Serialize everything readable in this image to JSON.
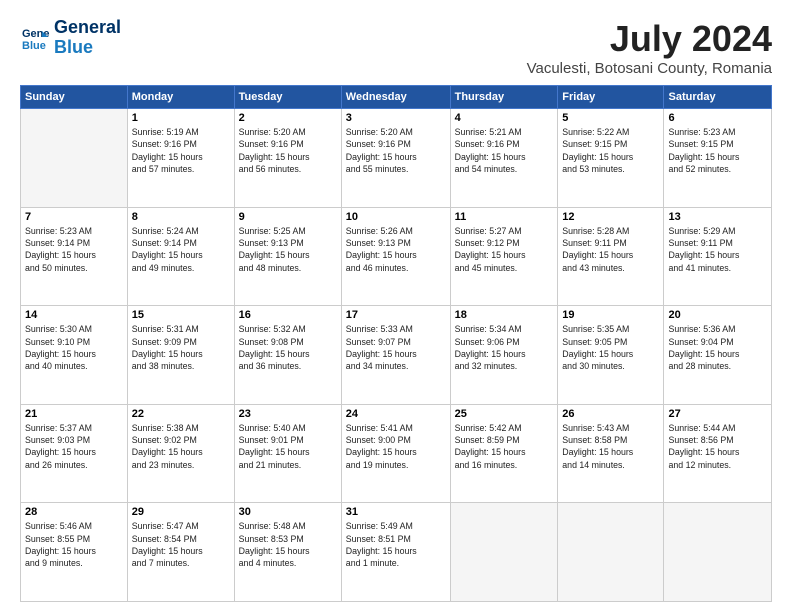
{
  "header": {
    "logo_line1": "General",
    "logo_line2": "Blue",
    "title": "July 2024",
    "subtitle": "Vaculesti, Botosani County, Romania"
  },
  "weekdays": [
    "Sunday",
    "Monday",
    "Tuesday",
    "Wednesday",
    "Thursday",
    "Friday",
    "Saturday"
  ],
  "weeks": [
    [
      {
        "day": "",
        "info": ""
      },
      {
        "day": "1",
        "info": "Sunrise: 5:19 AM\nSunset: 9:16 PM\nDaylight: 15 hours\nand 57 minutes."
      },
      {
        "day": "2",
        "info": "Sunrise: 5:20 AM\nSunset: 9:16 PM\nDaylight: 15 hours\nand 56 minutes."
      },
      {
        "day": "3",
        "info": "Sunrise: 5:20 AM\nSunset: 9:16 PM\nDaylight: 15 hours\nand 55 minutes."
      },
      {
        "day": "4",
        "info": "Sunrise: 5:21 AM\nSunset: 9:16 PM\nDaylight: 15 hours\nand 54 minutes."
      },
      {
        "day": "5",
        "info": "Sunrise: 5:22 AM\nSunset: 9:15 PM\nDaylight: 15 hours\nand 53 minutes."
      },
      {
        "day": "6",
        "info": "Sunrise: 5:23 AM\nSunset: 9:15 PM\nDaylight: 15 hours\nand 52 minutes."
      }
    ],
    [
      {
        "day": "7",
        "info": "Sunrise: 5:23 AM\nSunset: 9:14 PM\nDaylight: 15 hours\nand 50 minutes."
      },
      {
        "day": "8",
        "info": "Sunrise: 5:24 AM\nSunset: 9:14 PM\nDaylight: 15 hours\nand 49 minutes."
      },
      {
        "day": "9",
        "info": "Sunrise: 5:25 AM\nSunset: 9:13 PM\nDaylight: 15 hours\nand 48 minutes."
      },
      {
        "day": "10",
        "info": "Sunrise: 5:26 AM\nSunset: 9:13 PM\nDaylight: 15 hours\nand 46 minutes."
      },
      {
        "day": "11",
        "info": "Sunrise: 5:27 AM\nSunset: 9:12 PM\nDaylight: 15 hours\nand 45 minutes."
      },
      {
        "day": "12",
        "info": "Sunrise: 5:28 AM\nSunset: 9:11 PM\nDaylight: 15 hours\nand 43 minutes."
      },
      {
        "day": "13",
        "info": "Sunrise: 5:29 AM\nSunset: 9:11 PM\nDaylight: 15 hours\nand 41 minutes."
      }
    ],
    [
      {
        "day": "14",
        "info": "Sunrise: 5:30 AM\nSunset: 9:10 PM\nDaylight: 15 hours\nand 40 minutes."
      },
      {
        "day": "15",
        "info": "Sunrise: 5:31 AM\nSunset: 9:09 PM\nDaylight: 15 hours\nand 38 minutes."
      },
      {
        "day": "16",
        "info": "Sunrise: 5:32 AM\nSunset: 9:08 PM\nDaylight: 15 hours\nand 36 minutes."
      },
      {
        "day": "17",
        "info": "Sunrise: 5:33 AM\nSunset: 9:07 PM\nDaylight: 15 hours\nand 34 minutes."
      },
      {
        "day": "18",
        "info": "Sunrise: 5:34 AM\nSunset: 9:06 PM\nDaylight: 15 hours\nand 32 minutes."
      },
      {
        "day": "19",
        "info": "Sunrise: 5:35 AM\nSunset: 9:05 PM\nDaylight: 15 hours\nand 30 minutes."
      },
      {
        "day": "20",
        "info": "Sunrise: 5:36 AM\nSunset: 9:04 PM\nDaylight: 15 hours\nand 28 minutes."
      }
    ],
    [
      {
        "day": "21",
        "info": "Sunrise: 5:37 AM\nSunset: 9:03 PM\nDaylight: 15 hours\nand 26 minutes."
      },
      {
        "day": "22",
        "info": "Sunrise: 5:38 AM\nSunset: 9:02 PM\nDaylight: 15 hours\nand 23 minutes."
      },
      {
        "day": "23",
        "info": "Sunrise: 5:40 AM\nSunset: 9:01 PM\nDaylight: 15 hours\nand 21 minutes."
      },
      {
        "day": "24",
        "info": "Sunrise: 5:41 AM\nSunset: 9:00 PM\nDaylight: 15 hours\nand 19 minutes."
      },
      {
        "day": "25",
        "info": "Sunrise: 5:42 AM\nSunset: 8:59 PM\nDaylight: 15 hours\nand 16 minutes."
      },
      {
        "day": "26",
        "info": "Sunrise: 5:43 AM\nSunset: 8:58 PM\nDaylight: 15 hours\nand 14 minutes."
      },
      {
        "day": "27",
        "info": "Sunrise: 5:44 AM\nSunset: 8:56 PM\nDaylight: 15 hours\nand 12 minutes."
      }
    ],
    [
      {
        "day": "28",
        "info": "Sunrise: 5:46 AM\nSunset: 8:55 PM\nDaylight: 15 hours\nand 9 minutes."
      },
      {
        "day": "29",
        "info": "Sunrise: 5:47 AM\nSunset: 8:54 PM\nDaylight: 15 hours\nand 7 minutes."
      },
      {
        "day": "30",
        "info": "Sunrise: 5:48 AM\nSunset: 8:53 PM\nDaylight: 15 hours\nand 4 minutes."
      },
      {
        "day": "31",
        "info": "Sunrise: 5:49 AM\nSunset: 8:51 PM\nDaylight: 15 hours\nand 1 minute."
      },
      {
        "day": "",
        "info": ""
      },
      {
        "day": "",
        "info": ""
      },
      {
        "day": "",
        "info": ""
      }
    ]
  ]
}
